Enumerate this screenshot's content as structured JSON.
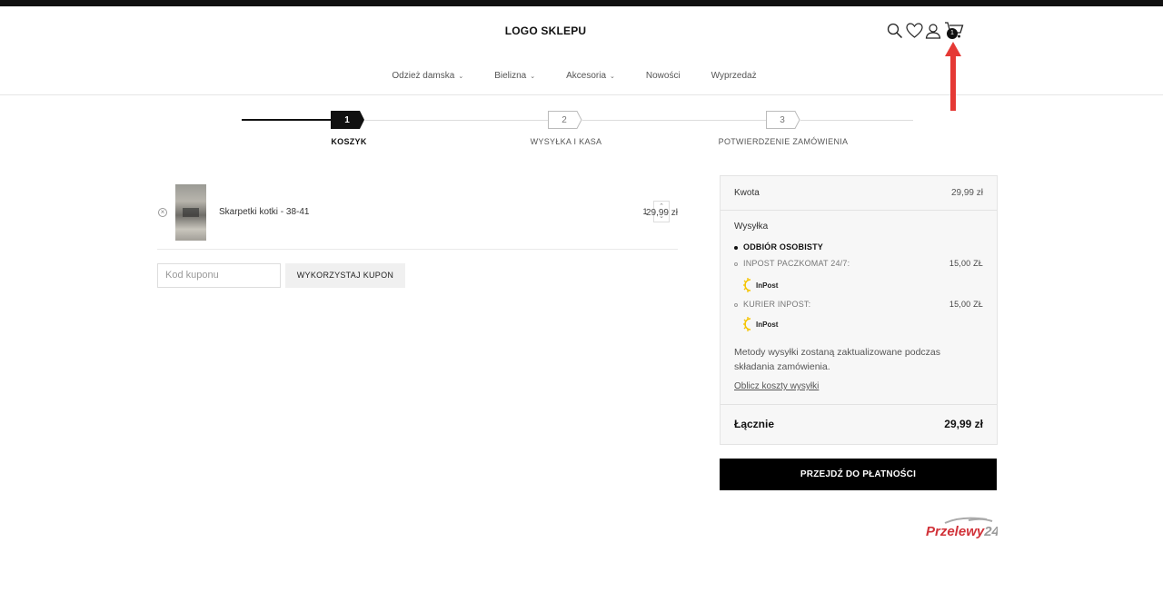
{
  "header": {
    "logo": "LOGO SKLEPU",
    "cart_count": "1",
    "icons": [
      "search-icon",
      "heart-icon",
      "user-icon",
      "cart-icon"
    ]
  },
  "nav": {
    "items": [
      {
        "label": "Odzież damska",
        "has_dropdown": true
      },
      {
        "label": "Bielizna",
        "has_dropdown": true
      },
      {
        "label": "Akcesoria",
        "has_dropdown": true
      },
      {
        "label": "Nowości",
        "has_dropdown": false
      },
      {
        "label": "Wyprzedaż",
        "has_dropdown": false
      }
    ]
  },
  "steps": [
    {
      "number": "1",
      "label": "KOSZYK",
      "active": true
    },
    {
      "number": "2",
      "label": "WYSYŁKA I KASA",
      "active": false
    },
    {
      "number": "3",
      "label": "POTWIERDZENIE ZAMÓWIENIA",
      "active": false
    }
  ],
  "cart": {
    "items": [
      {
        "name": "Skarpetki kotki - 38-41",
        "quantity": "1",
        "price": "29,99 zł"
      }
    ],
    "coupon_placeholder": "Kod kuponu",
    "coupon_button": "WYKORZYSTAJ KUPON"
  },
  "summary": {
    "subtotal_label": "Kwota",
    "subtotal_value": "29,99 zł",
    "shipping_label": "Wysyłka",
    "shipping_options": [
      {
        "label": "ODBIÓR OSOBISTY",
        "price": "",
        "selected": true,
        "logo": ""
      },
      {
        "label": "INPOST PACZKOMAT 24/7:",
        "price": "15,00 ZŁ",
        "selected": false,
        "logo": "InPost"
      },
      {
        "label": "KURIER INPOST:",
        "price": "15,00 ZŁ",
        "selected": false,
        "logo": "InPost"
      }
    ],
    "shipping_note": "Metody wysyłki zostaną zaktualizowane podczas składania zamówienia.",
    "calc_link": "Oblicz koszty wysyłki",
    "total_label": "Łącznie",
    "total_value": "29,99 zł"
  },
  "checkout_button": "PRZEJDŹ DO PŁATNOŚCI",
  "payment_logo": "Przelewy24",
  "colors": {
    "accent": "#000000",
    "arrow": "#e53935",
    "inpost": "#f5c400"
  }
}
